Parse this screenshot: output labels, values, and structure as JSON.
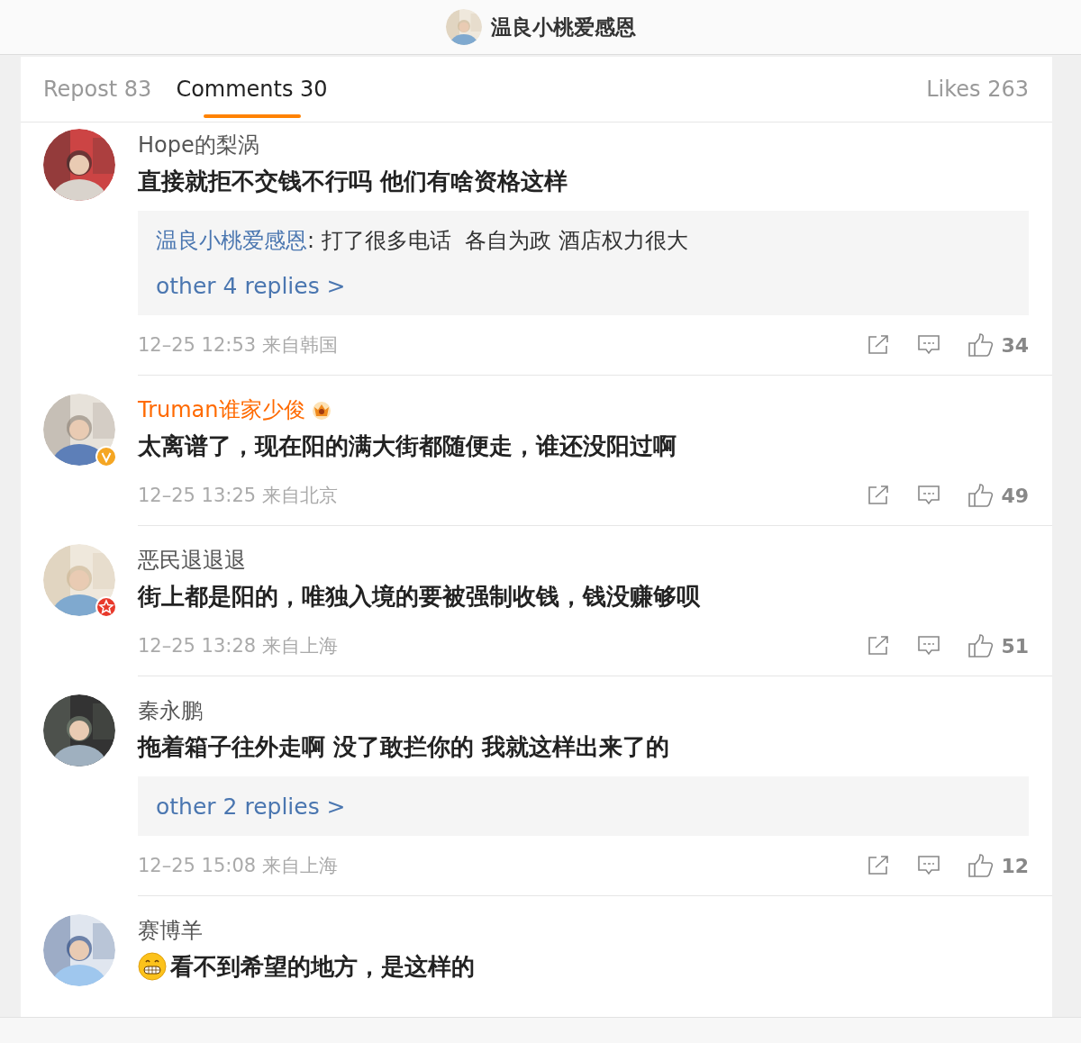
{
  "header": {
    "title": "温良小桃爱感恩"
  },
  "tabs": [
    {
      "label": "Repost 83",
      "selected": false
    },
    {
      "label": "Comments 30",
      "selected": true
    },
    {
      "label": "Likes 263",
      "selected": false
    }
  ],
  "comments": [
    {
      "author": "Hope的梨涡",
      "highlighted": false,
      "content": "直接就拒不交钱不行吗 他们有啥资格这样",
      "replies": [
        {
          "author": "温良小桃爱感恩",
          "text": ": 打了很多电话  各自为政 酒店权力很大"
        }
      ],
      "more_replies": "other 4 replies >",
      "time": "12–25 12:53 来自韩国",
      "likes": "34"
    },
    {
      "author": "Truman谁家少俊",
      "highlighted": true,
      "verified": true,
      "content": "太离谱了，现在阳的满大街都随便走，谁还没阳过啊",
      "time": "12–25 13:25 来自北京",
      "likes": "49"
    },
    {
      "author": "恶民退退退",
      "highlighted": false,
      "star_member": true,
      "content": "街上都是阳的，唯独入境的要被强制收钱，钱没赚够呗",
      "time": "12–25 13:28 来自上海",
      "likes": "51"
    },
    {
      "author": "秦永鹏",
      "highlighted": false,
      "content": "拖着箱子往外走啊 没了敢拦你的 我就这样出来了的",
      "more_replies": "other 2 replies >",
      "time": "12–25 15:08 来自上海",
      "likes": "12"
    },
    {
      "author": "赛博羊",
      "highlighted": false,
      "leading_emoji": true,
      "content": "看不到希望的地方，是这样的"
    }
  ]
}
